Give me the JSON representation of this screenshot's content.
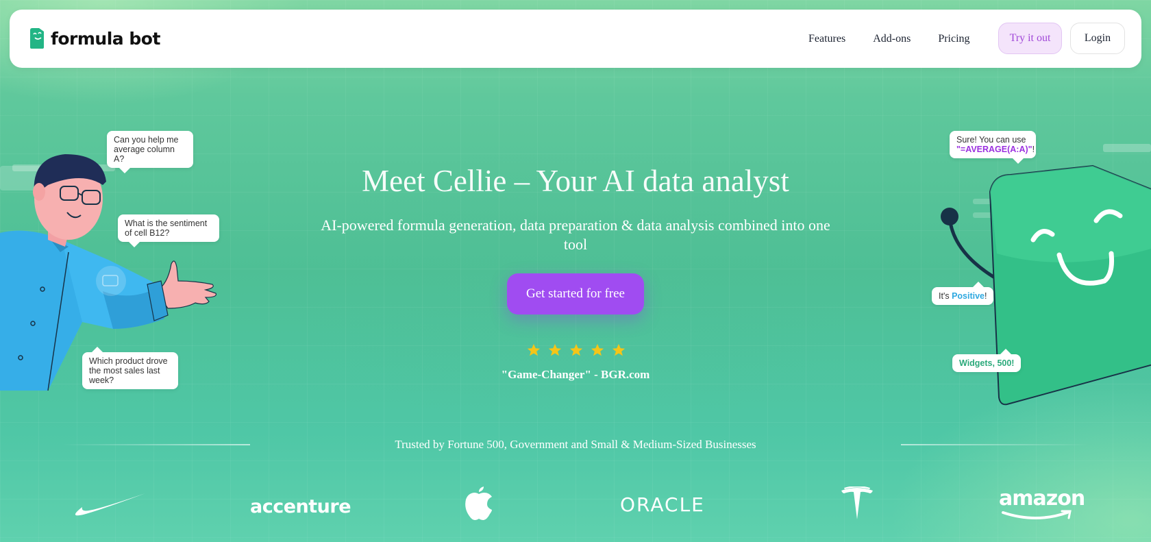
{
  "brand": {
    "name": "formula bot",
    "color": "#22b585"
  },
  "nav": {
    "links": [
      "Features",
      "Add-ons",
      "Pricing"
    ],
    "try_label": "Try it out",
    "login_label": "Login"
  },
  "hero": {
    "title": "Meet Cellie – Your AI data analyst",
    "subtitle": "AI-powered formula generation, data preparation & data analysis combined into one tool",
    "cta_label": "Get started for free",
    "rating_stars": 5,
    "quote": "\"Game-Changer\" - BGR.com"
  },
  "trusted": {
    "text": "Trusted by Fortune 500, Government and Small & Medium-Sized Businesses",
    "logos": {
      "nike": "nike-logo",
      "accenture": "accenture",
      "apple": "apple-logo",
      "oracle": "ORACLE",
      "tesla": "tesla-logo",
      "amazon": "amazon"
    }
  },
  "bubbles": {
    "left_1": "Can you help me average column A?",
    "left_2": "What is the sentiment of cell B12?",
    "left_3": "Which product drove the most sales last week?",
    "right_1_prefix": "Sure! You can use",
    "right_1_formula": "\"=AVERAGE(A:A)\"",
    "right_1_suffix": "!",
    "right_2_prefix": "It's ",
    "right_2_highlight": "Positive",
    "right_2_suffix": "!",
    "right_3": "Widgets, 500!"
  },
  "colors": {
    "accent_purple": "#a04cf1",
    "star": "#f5c518",
    "background": "#4ebf95"
  }
}
